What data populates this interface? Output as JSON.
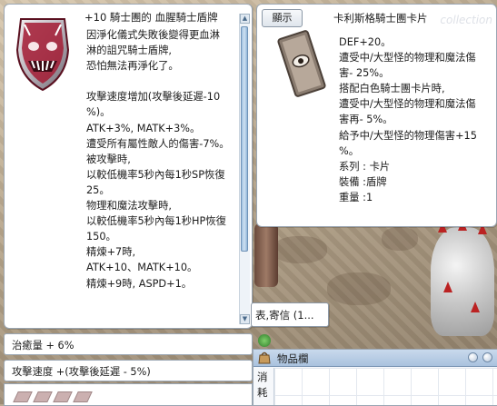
{
  "item": {
    "title": "+10 騎士團的 血腥騎士盾牌",
    "description": [
      "因淨化儀式失敗後變得更血淋",
      "淋的詛咒騎士盾牌,",
      "恐怕無法再淨化了。",
      "",
      "攻擊速度增加(攻擊後延遲-10",
      "%)。",
      "ATK+3%, MATK+3%。",
      "遭受所有屬性敵人的傷害-7%。",
      "被攻擊時,",
      "以較低機率5秒內每1秒SP恢復",
      "25。",
      "物理和魔法攻擊時,",
      "以較低機率5秒內每1秒HP恢復",
      "150。",
      "精煉+7時,",
      "ATK+10、MATK+10。",
      "精煉+9時, ASPD+1。"
    ]
  },
  "card": {
    "tab_label": "顯示",
    "title": "卡利斯格騎士團卡片",
    "watermark": "collection",
    "description": [
      "DEF+20。",
      "遭受中/大型怪的物理和魔法傷",
      "害- 25%。",
      "搭配白色騎士團卡片時,",
      "遭受中/大型怪的物理和魔法傷",
      "害再- 5%。",
      "給予中/大型怪的物理傷害+15",
      "%。",
      "系列 : 卡片",
      "裝備 :盾牌",
      "重量 :1"
    ]
  },
  "chat": {
    "text": "表,寄信 (1..."
  },
  "stats": {
    "heal": "治癒量 + 6%",
    "aspd": "攻擊速度 +(攻擊後延遲 - 5%)"
  },
  "inventory": {
    "title": "物品欄",
    "tab_chars": [
      "消",
      "耗"
    ]
  },
  "colors": {
    "window_border": "#9aa6b3",
    "scroll_thumb": "#9fc1e0",
    "inventory_titlebar": "#a9c2de"
  },
  "icons": [
    "shield-item-icon",
    "card-item-icon",
    "inventory-bag-icon",
    "scroll-up-icon",
    "scroll-down-icon"
  ]
}
